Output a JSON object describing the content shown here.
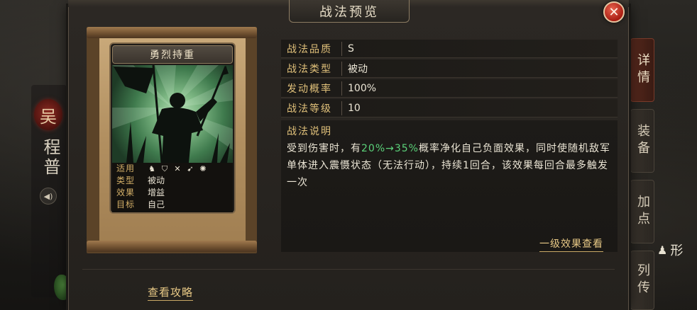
{
  "window": {
    "title": "战法预览",
    "close_icon": "close-icon"
  },
  "hero": {
    "faction_char": "吴",
    "name": "程普"
  },
  "side_tabs": [
    {
      "label": "详情",
      "active": true
    },
    {
      "label": "装备",
      "active": false
    },
    {
      "label": "加点",
      "active": false
    },
    {
      "label": "列传",
      "active": false
    }
  ],
  "right_partial": {
    "label": "形"
  },
  "skill_card": {
    "name": "勇烈持重",
    "info": {
      "applicable_label": "适用",
      "applicable_icons": [
        "cavalry-icon",
        "shield-icon",
        "crossed-swords-icon",
        "spear-icon",
        "siege-icon"
      ],
      "type_label": "类型",
      "type_value": "被动",
      "effect_label": "效果",
      "effect_value": "增益",
      "target_label": "目标",
      "target_value": "自己"
    }
  },
  "attributes": [
    {
      "key": "战法品质",
      "value": "S"
    },
    {
      "key": "战法类型",
      "value": "被动"
    },
    {
      "key": "发动概率",
      "value": "100%"
    },
    {
      "key": "战法等级",
      "value": "10"
    }
  ],
  "description": {
    "title": "战法说明",
    "text_before": "受到伤害时，有",
    "highlight": "20%→35%",
    "text_after": "概率净化自己负面效果，同时使随机敌军单体进入震慑状态（无法行动），持续1回合，该效果每回合最多触发一次",
    "highlight_color": "#5bd27a"
  },
  "links": {
    "first_level_effect": "一级效果查看",
    "view_guide": "查看攻略"
  },
  "colors": {
    "accent_gold": "#e0c07a",
    "close_red": "#c0301f"
  }
}
